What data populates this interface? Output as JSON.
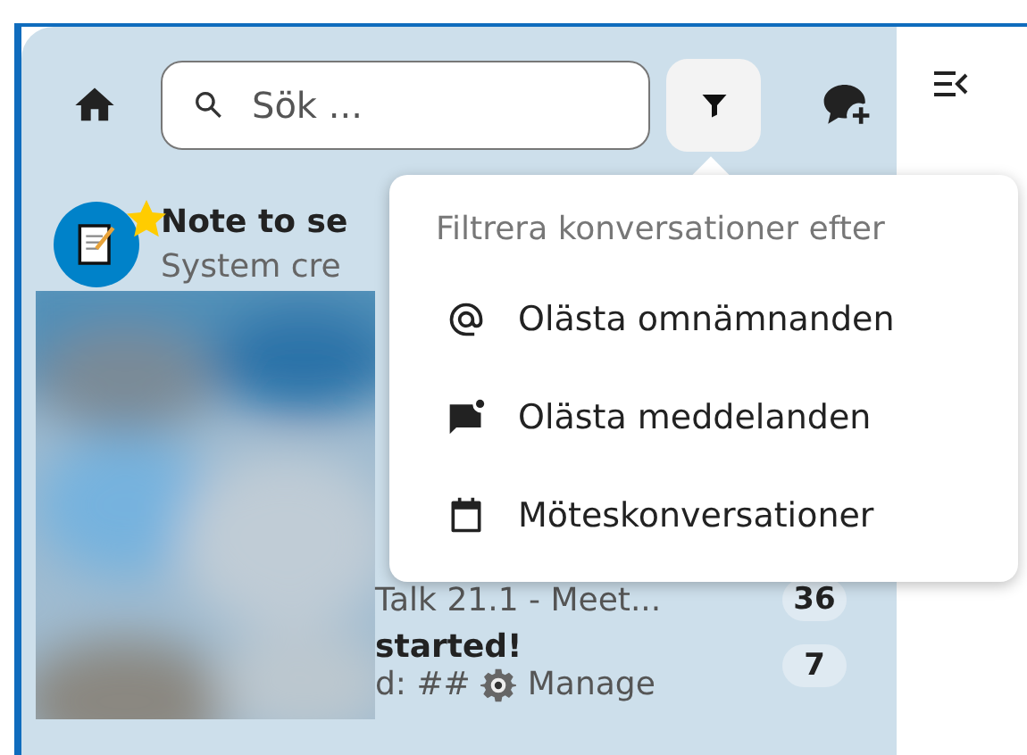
{
  "header": {
    "search": {
      "placeholder": "Sök ..."
    },
    "filter": {
      "expanded": true
    }
  },
  "conversations": [
    {
      "title": "Note to se",
      "subtitle": "System cre",
      "favorite": true
    }
  ],
  "partial_rows": [
    {
      "subtitle": "Talk 21.1 - Meet...",
      "badge": "36"
    },
    {
      "title": "started!",
      "subtitle": "d: ##",
      "subtitle_end": "Manage",
      "badge": "7"
    }
  ],
  "filter_menu": {
    "title": "Filtrera konversationer efter",
    "items": [
      {
        "kind": "mention",
        "label": "Olästa omnämnanden"
      },
      {
        "kind": "unread",
        "label": "Olästa meddelanden"
      },
      {
        "kind": "meeting",
        "label": "Möteskonversationer"
      }
    ]
  }
}
